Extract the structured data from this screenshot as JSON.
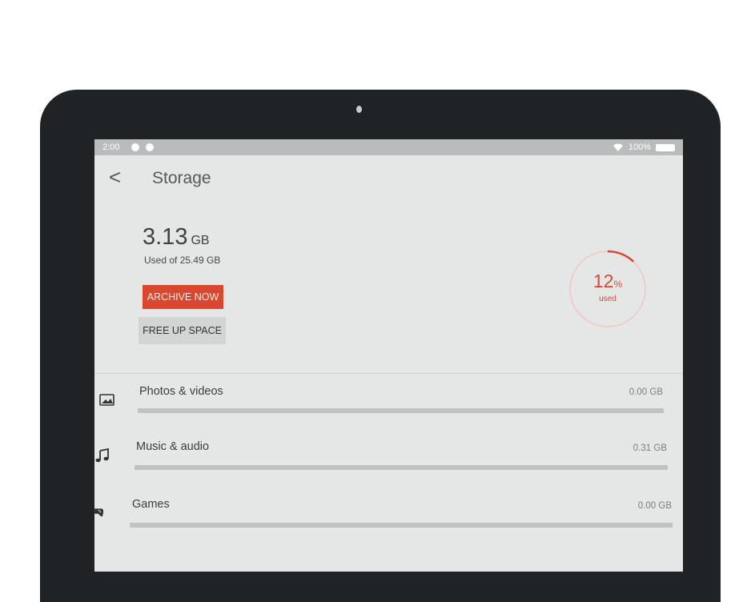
{
  "status_bar": {
    "time": "2:00",
    "battery": "100%"
  },
  "header": {
    "back_glyph": "<",
    "title": "Storage"
  },
  "usage": {
    "used_value": "3.13",
    "used_unit": "GB",
    "used_of": "Used of 25.49 GB",
    "percent_value": "12",
    "percent_sign": "%",
    "percent_label": "used",
    "fraction": 0.12
  },
  "actions": {
    "archive_label": "ARCHIVE NOW",
    "free_up_label": "FREE UP SPACE"
  },
  "categories": [
    {
      "label": "Photos & videos",
      "size": "0.00 GB",
      "fraction": 0.0,
      "icon": "photos-icon"
    },
    {
      "label": "Music & audio",
      "size": "0.31 GB",
      "fraction": 0.0,
      "icon": "music-icon"
    },
    {
      "label": "Games",
      "size": "0.00 GB",
      "fraction": 0.0,
      "icon": "gamepad-icon"
    }
  ],
  "colors": {
    "accent": "#d9472f",
    "bezel": "#1f2326",
    "screen": "#e5e7e6"
  }
}
